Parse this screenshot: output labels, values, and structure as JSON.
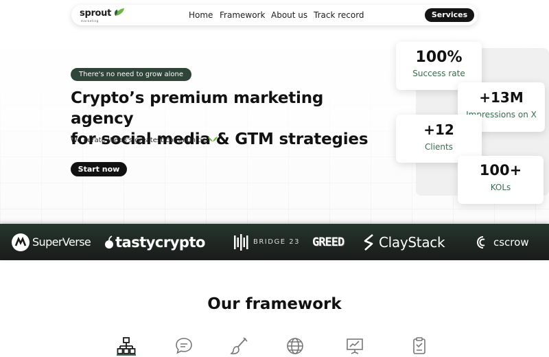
{
  "nav": {
    "logo": "sprout",
    "logo_tagline": "marketing",
    "links": [
      "Home",
      "Framework",
      "About us",
      "Track record"
    ],
    "cta": "Services"
  },
  "hero": {
    "badge": "There's no need to grow alone",
    "headline_line1": "Crypto’s premium marketing agency",
    "headline_line2": "for social media & GTM strategies",
    "subtext": "We curate Web3's greatest communities",
    "cta": "Start now"
  },
  "stats": [
    {
      "value": "100%",
      "label": "Success rate"
    },
    {
      "value": "+13M",
      "label": "Impressions on X"
    },
    {
      "value": "+12",
      "label": "Clients"
    },
    {
      "value": "100+",
      "label": "KOLs"
    }
  ],
  "partners": [
    {
      "name": "SuperVerse",
      "icon": "superverse-logo-icon"
    },
    {
      "name": "tastycrypto",
      "icon": "tastycrypto-logo-icon"
    },
    {
      "name": "BRIDGE 23",
      "icon": "bridge23-logo-icon"
    },
    {
      "name": "GREED",
      "icon": "greed-logo-icon"
    },
    {
      "name": "ClayStack",
      "icon": "claystack-logo-icon"
    },
    {
      "name": "cscrow",
      "icon": "cscrow-logo-icon"
    }
  ],
  "framework": {
    "title": "Our framework",
    "icons": [
      "hierarchy-icon",
      "chat-icon",
      "brush-icon",
      "globe-icon",
      "presentation-chart-icon",
      "clipboard-icon"
    ]
  },
  "colors": {
    "accent_green": "#3b6a50",
    "badge_green": "#30453a",
    "leaf_green": "#6fb34a",
    "dark": "#111111"
  }
}
